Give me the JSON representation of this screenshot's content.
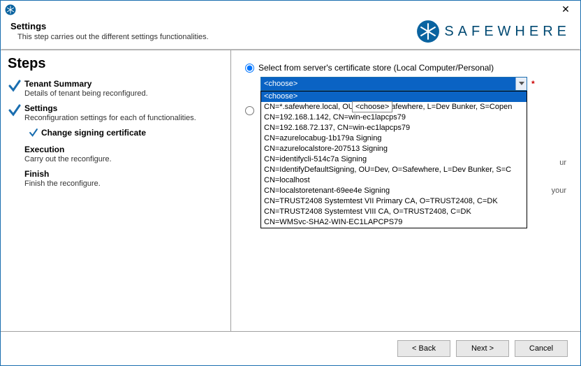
{
  "header": {
    "title": "Settings",
    "subtitle": "This step carries out the different settings functionalities."
  },
  "brand": {
    "name": "SAFEWHERE"
  },
  "steps_heading": "Steps",
  "steps": [
    {
      "title": "Tenant Summary",
      "desc": "Details of tenant being reconfigured.",
      "completed": true
    },
    {
      "title": "Settings",
      "desc": "Reconfiguration settings for each of functionalities.",
      "completed": true
    },
    {
      "title": "Execution",
      "desc": "Carry out the reconfigure.",
      "completed": false
    },
    {
      "title": "Finish",
      "desc": "Finish the reconfigure.",
      "completed": false
    }
  ],
  "substep": {
    "title": "Change signing certificate"
  },
  "main": {
    "option1_label": "Select from server's certificate store (Local Computer/Personal)",
    "combo_value": "<choose>",
    "required_mark": "*",
    "tooltip": "<choose>",
    "dropdown": [
      "<choose>",
      "CN=*.safewhere.local, OU=Dev, O=Safewhere, L=Dev Bunker, S=Copen",
      "CN=192.168.1.142, CN=win-ec1lapcps79",
      "CN=192.168.72.137, CN=win-ec1lapcps79",
      "CN=azurelocabug-1b179a Signing",
      "CN=azurelocalstore-207513 Signing",
      "CN=identifycli-514c7a Signing",
      "CN=IdentifyDefaultSigning, OU=Dev, O=Safewhere, L=Dev Bunker, S=C",
      "CN=localhost",
      "CN=localstoretenant-69ee4e Signing",
      "CN=TRUST2408 Systemtest VII Primary CA, O=TRUST2408, C=DK",
      "CN=TRUST2408 Systemtest VIII CA, O=TRUST2408, C=DK",
      "CN=WMSvc-SHA2-WIN-EC1LAPCPS79"
    ],
    "ghost_fragments": {
      "a": "ur",
      "b": "your"
    }
  },
  "buttons": {
    "back": "< Back",
    "next": "Next >",
    "cancel": "Cancel"
  }
}
